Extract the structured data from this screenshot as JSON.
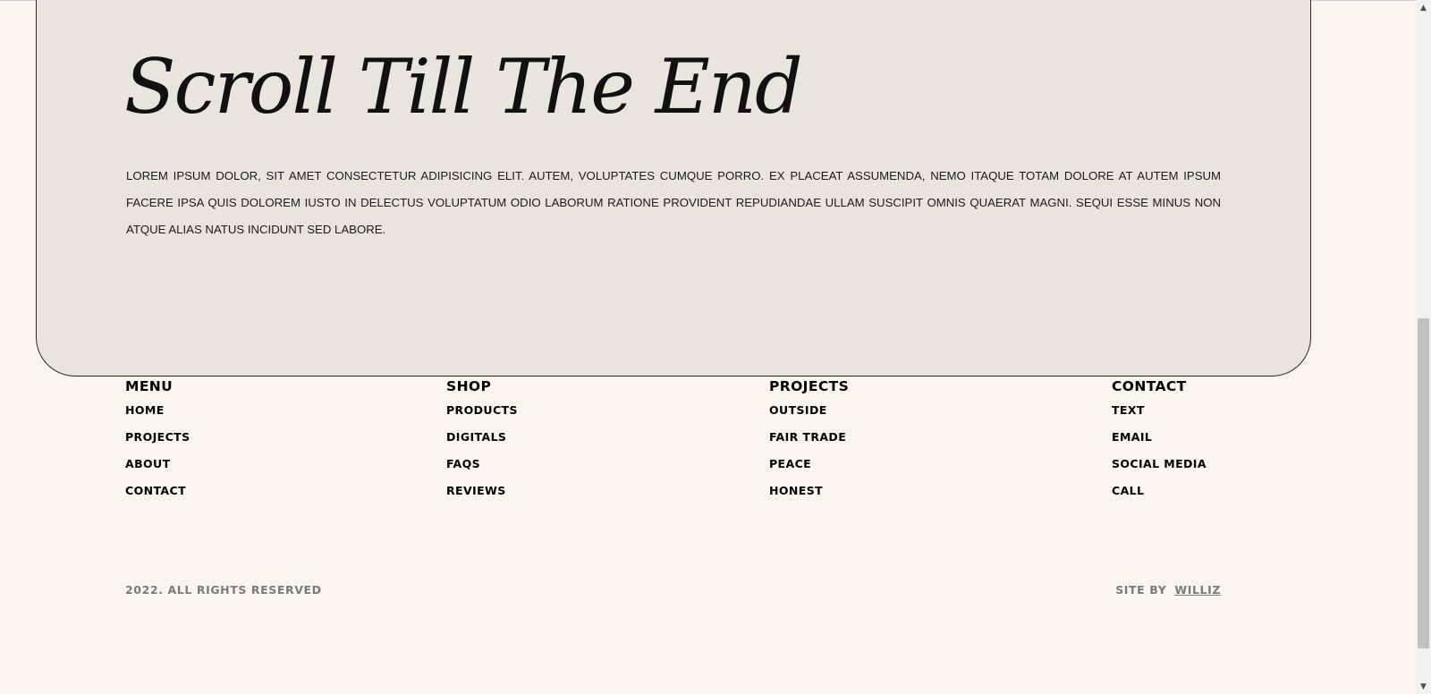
{
  "hero": {
    "title": "Scroll Till The End",
    "body": "Lorem ipsum dolor, sit amet consectetur adipisicing elit. Autem, voluptates cumque porro. Ex placeat assumenda, nemo itaque totam dolore at autem ipsum facere ipsa quis dolorem iusto in delectus voluptatum odio laborum ratione provident repudiandae ullam suscipit omnis quaerat magni. Sequi esse minus non atque alias natus incidunt sed labore."
  },
  "footer": {
    "menu": {
      "heading": "MENU",
      "links": [
        "HOME",
        "PROJECTS",
        "ABOUT",
        "CONTACT"
      ]
    },
    "shop": {
      "heading": "SHOP",
      "links": [
        "PRODUCTS",
        "DIGITALS",
        "FAQS",
        "REVIEWS"
      ]
    },
    "projects": {
      "heading": "PROJECTS",
      "links": [
        "OUTSIDE",
        "FAIR TRADE",
        "PEACE",
        "HONEST"
      ]
    },
    "contact": {
      "heading": "CONTACT",
      "links": [
        "TEXT",
        "EMAIL",
        "SOCIAL MEDIA",
        "CALL"
      ]
    },
    "copyright": "2022. ALL RIGHTS RESERVED",
    "site_by_label": "SITE BY",
    "site_by_author": "WILLIZ"
  },
  "scrollbar": {
    "up_icon": "▲",
    "down_icon": "▼",
    "scroll_position": 0.62
  },
  "colors": {
    "page_bg": "#f9f6f0",
    "card_bg": "#e8e6dc",
    "muted_text": "#7a7a7a"
  }
}
